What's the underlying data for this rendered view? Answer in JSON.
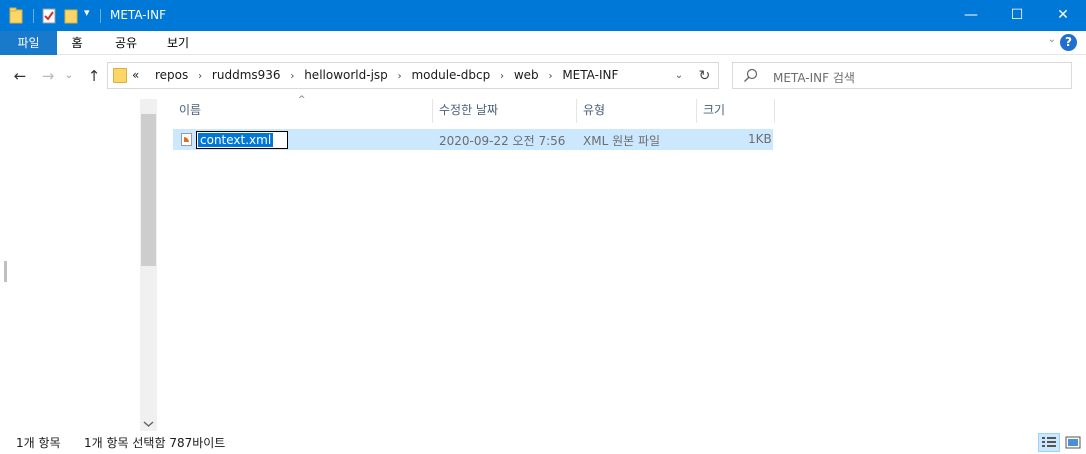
{
  "window": {
    "title": "META-INF",
    "minimize": "—",
    "maximize": "☐",
    "close": "✕"
  },
  "quick_access": {
    "dropdown": "▾"
  },
  "ribbon": {
    "tabs": [
      {
        "label": "파일"
      },
      {
        "label": "홈"
      },
      {
        "label": "공유"
      },
      {
        "label": "보기"
      }
    ],
    "help": "?",
    "expand": "⌄"
  },
  "nav": {
    "back": "←",
    "forward": "→",
    "recent": "⌄",
    "up": "↑"
  },
  "address": {
    "overflow": "«",
    "crumbs": [
      "repos",
      "ruddms936",
      "helloworld-jsp",
      "module-dbcp",
      "web",
      "META-INF"
    ],
    "separator": "›",
    "dropdown": "⌄",
    "refresh": "↻"
  },
  "search": {
    "placeholder": "META-INF 검색"
  },
  "columns": {
    "name": "이름",
    "date": "수정한 날짜",
    "type": "유형",
    "size": "크기",
    "sort_indicator": "^"
  },
  "files": [
    {
      "name": "context.xml",
      "date": "2020-09-22 오전 7:56",
      "type": "XML 원본 파일",
      "size": "1KB"
    }
  ],
  "status": {
    "item_count": "1개 항목",
    "selection": "1개 항목 선택함 787바이트"
  },
  "colors": {
    "titlebar": "#0078d7",
    "selection": "#cce8ff",
    "folder": "#fcd667"
  }
}
